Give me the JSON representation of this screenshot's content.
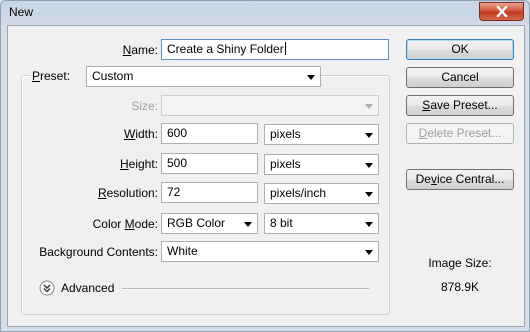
{
  "window": {
    "title": "New"
  },
  "name": {
    "label_pre": "",
    "label_u": "N",
    "label_post": "ame:",
    "value": "Create a Shiny Folder"
  },
  "preset": {
    "label_u": "P",
    "label_post": "reset:",
    "value": "Custom"
  },
  "size": {
    "label": "Size:",
    "value": ""
  },
  "width": {
    "label_u": "W",
    "label_post": "idth:",
    "value": "600",
    "unit": "pixels"
  },
  "height": {
    "label_u": "H",
    "label_post": "eight:",
    "value": "500",
    "unit": "pixels"
  },
  "resolution": {
    "label_u": "R",
    "label_post": "esolution:",
    "value": "72",
    "unit": "pixels/inch"
  },
  "color_mode": {
    "label_pre": "Color ",
    "label_u": "M",
    "label_post": "ode:",
    "mode": "RGB Color",
    "depth": "8 bit"
  },
  "background": {
    "label": "Background Contents:",
    "value": "White"
  },
  "advanced": {
    "label": "Advanced"
  },
  "buttons": {
    "ok": "OK",
    "cancel": "Cancel",
    "save_preset_u": "S",
    "save_preset_rest": "ave Preset...",
    "delete_preset_u": "D",
    "delete_preset_rest": "elete Preset...",
    "device_central_pre": "De",
    "device_central_u": "v",
    "device_central_rest": "ice Central..."
  },
  "image_size": {
    "label": "Image Size:",
    "value": "878.9K"
  },
  "icons": {
    "close": "close-icon",
    "dropdown": "chevron-down-icon",
    "advanced": "double-chevron-down-icon"
  },
  "colors": {
    "close_button": "#c43b22",
    "default_button_border": "#3c7fb1"
  }
}
